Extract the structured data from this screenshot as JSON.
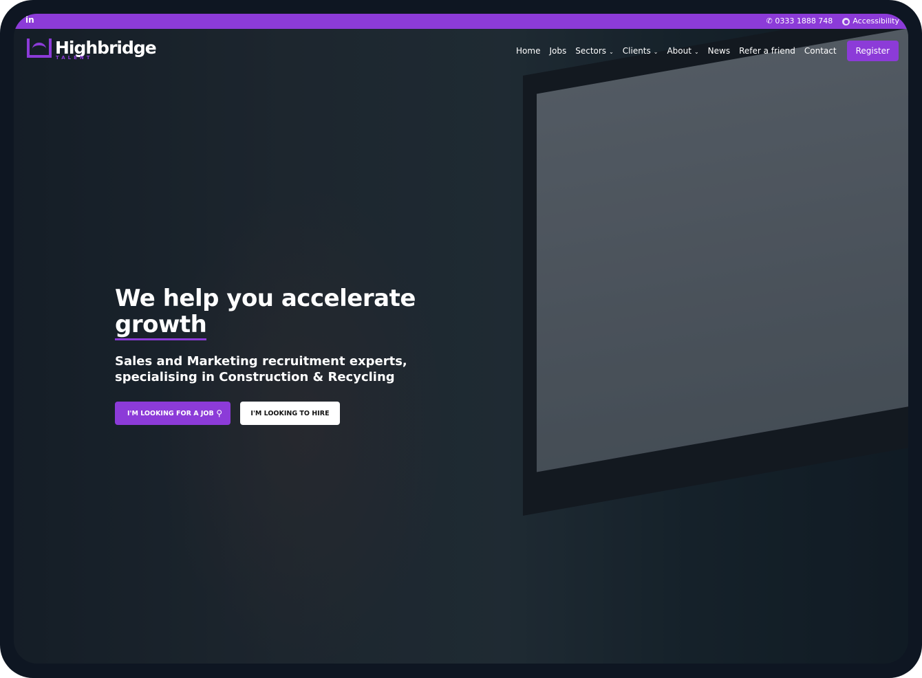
{
  "topbar": {
    "linkedin": "in",
    "phone": "0333 1888 748",
    "accessibility": "Accessibility",
    "accent_color": "#8c3bd8"
  },
  "logo": {
    "name": "Highbridge",
    "tagline": "TALENT"
  },
  "nav": {
    "items": [
      {
        "label": "Home"
      },
      {
        "label": "Jobs"
      },
      {
        "label": "Sectors",
        "dropdown": true
      },
      {
        "label": "Clients",
        "dropdown": true
      },
      {
        "label": "About",
        "dropdown": true
      },
      {
        "label": "News"
      },
      {
        "label": "Refer a friend"
      },
      {
        "label": "Contact"
      }
    ],
    "register": "Register"
  },
  "hero": {
    "title_start": "We help you accelerate",
    "title_emph": "growth",
    "subtitle": "Sales and Marketing recruitment experts, specialising in Construction & Recycling",
    "job_button": "I'M LOOKING FOR A JOB",
    "hire_button": "I'M LOOKING TO HIRE"
  }
}
